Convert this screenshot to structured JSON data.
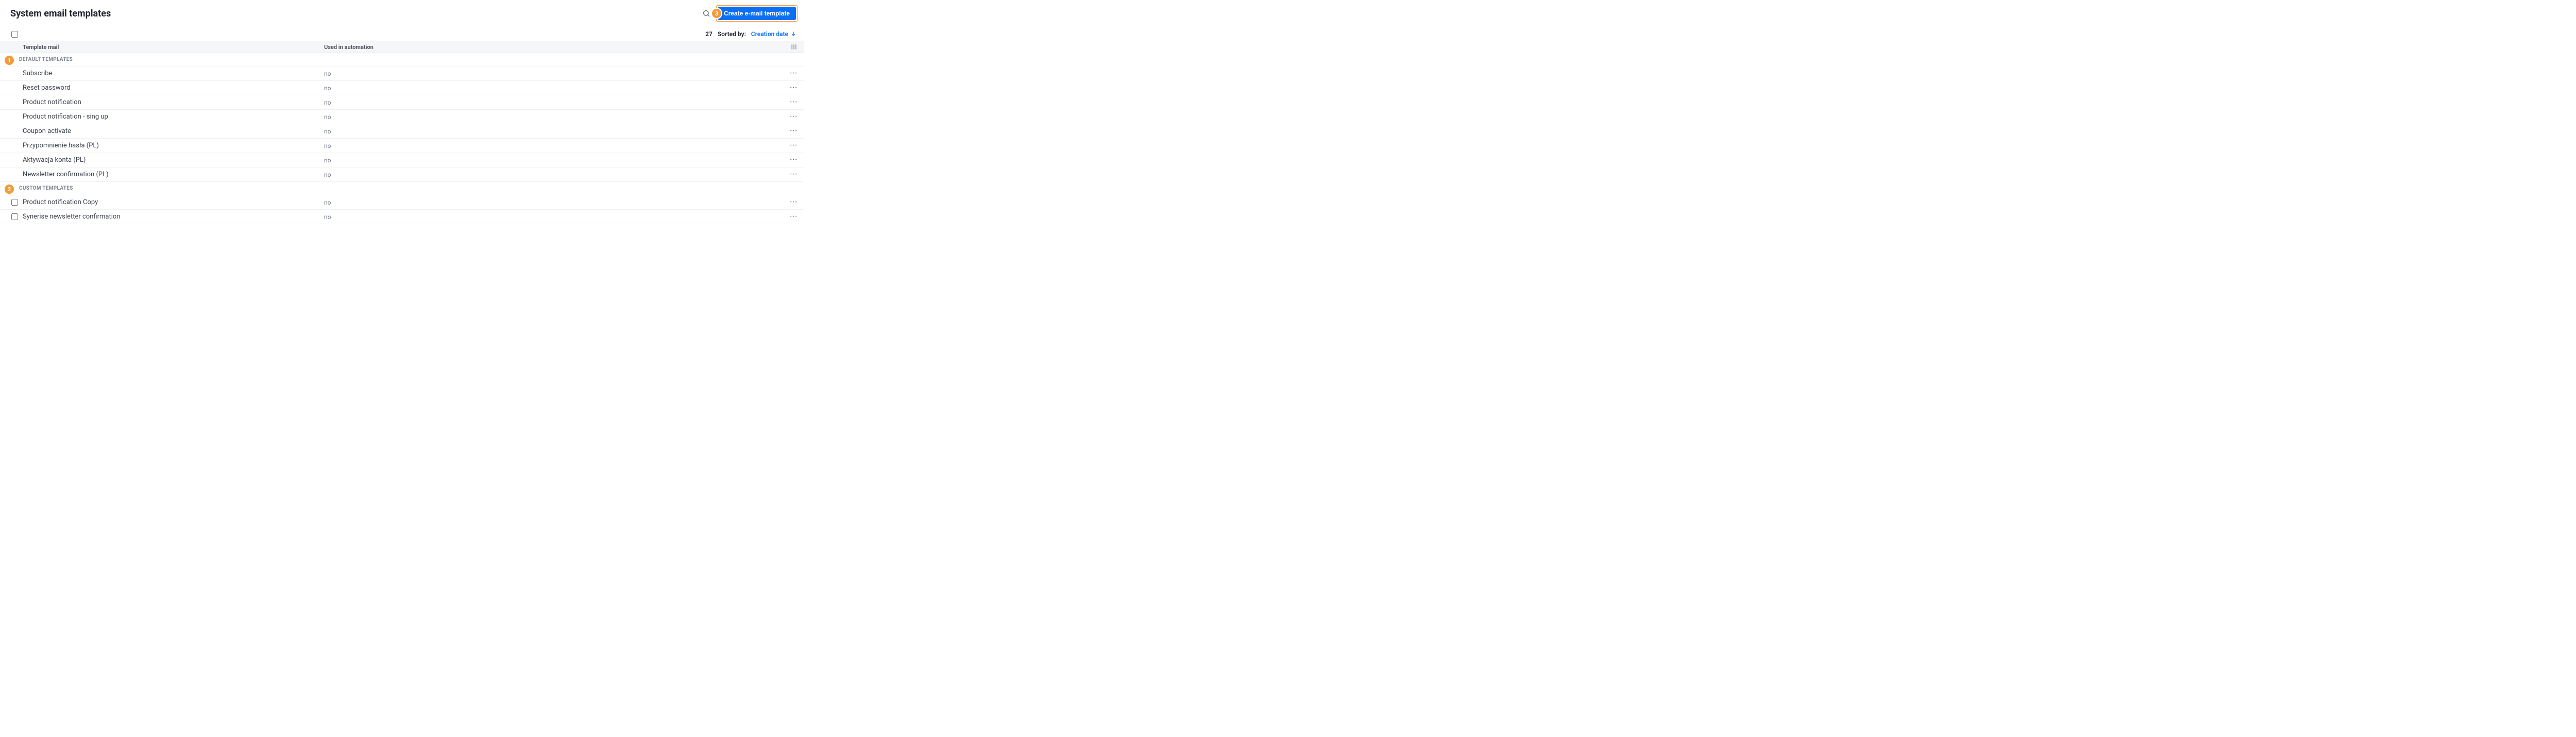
{
  "header": {
    "title": "System email templates",
    "create_label": "Create e-mail template",
    "callouts": {
      "create": "3"
    }
  },
  "toolbar": {
    "count": "27",
    "sorted_label": "Sorted by:",
    "sort_field": "Creation date"
  },
  "columns": {
    "name": "Template mail",
    "used": "Used in automation"
  },
  "sections": [
    {
      "title": "DEFAULT TEMPLATES",
      "callout": "1",
      "checkbox": false,
      "rows": [
        {
          "name": "Subscribe",
          "used": "no"
        },
        {
          "name": "Reset password",
          "used": "no"
        },
        {
          "name": "Product notification",
          "used": "no"
        },
        {
          "name": "Product notification - sing up",
          "used": "no"
        },
        {
          "name": "Coupon activate",
          "used": "no"
        },
        {
          "name": "Przypomnienie hasła (PL)",
          "used": "no"
        },
        {
          "name": "Aktywacja konta (PL)",
          "used": "no"
        },
        {
          "name": "Newsletter confirmation (PL)",
          "used": "no"
        }
      ]
    },
    {
      "title": "CUSTOM TEMPLATES",
      "callout": "2",
      "checkbox": true,
      "rows": [
        {
          "name": "Product notification Copy",
          "used": "no"
        },
        {
          "name": "Synerise newsletter confirmation",
          "used": "no"
        }
      ]
    }
  ]
}
